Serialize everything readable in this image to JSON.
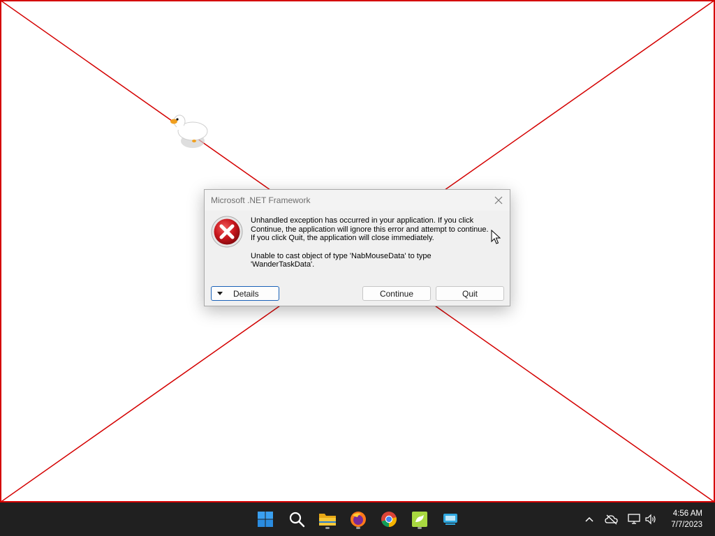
{
  "dialog": {
    "title": "Microsoft .NET Framework",
    "message_line1": "Unhandled exception has occurred in your application. If you click",
    "message_line2": "Continue, the application will ignore this error and attempt to continue.",
    "message_line3": "If you click Quit, the application will close immediately.",
    "message_line4": "Unable to cast object of type 'NabMouseData' to type",
    "message_line5": "'WanderTaskData'.",
    "details_label": "Details",
    "continue_label": "Continue",
    "quit_label": "Quit",
    "icon": "error-icon"
  },
  "taskbar": {
    "icons": [
      "windows-start-icon",
      "search-icon",
      "file-explorer-icon",
      "firefox-icon",
      "chrome-icon",
      "goose-app-icon",
      "remote-desktop-icon"
    ],
    "tray_icons": [
      "chevron-up-icon",
      "onedrive-offline-icon",
      "network-icon",
      "volume-icon"
    ]
  },
  "clock": {
    "time": "4:56 AM",
    "date": "7/7/2023"
  },
  "colors": {
    "frame_red": "#d40000",
    "taskbar_bg": "#202020",
    "dialog_bg": "#f0f0f0",
    "accent_blue": "#1a62b8"
  }
}
